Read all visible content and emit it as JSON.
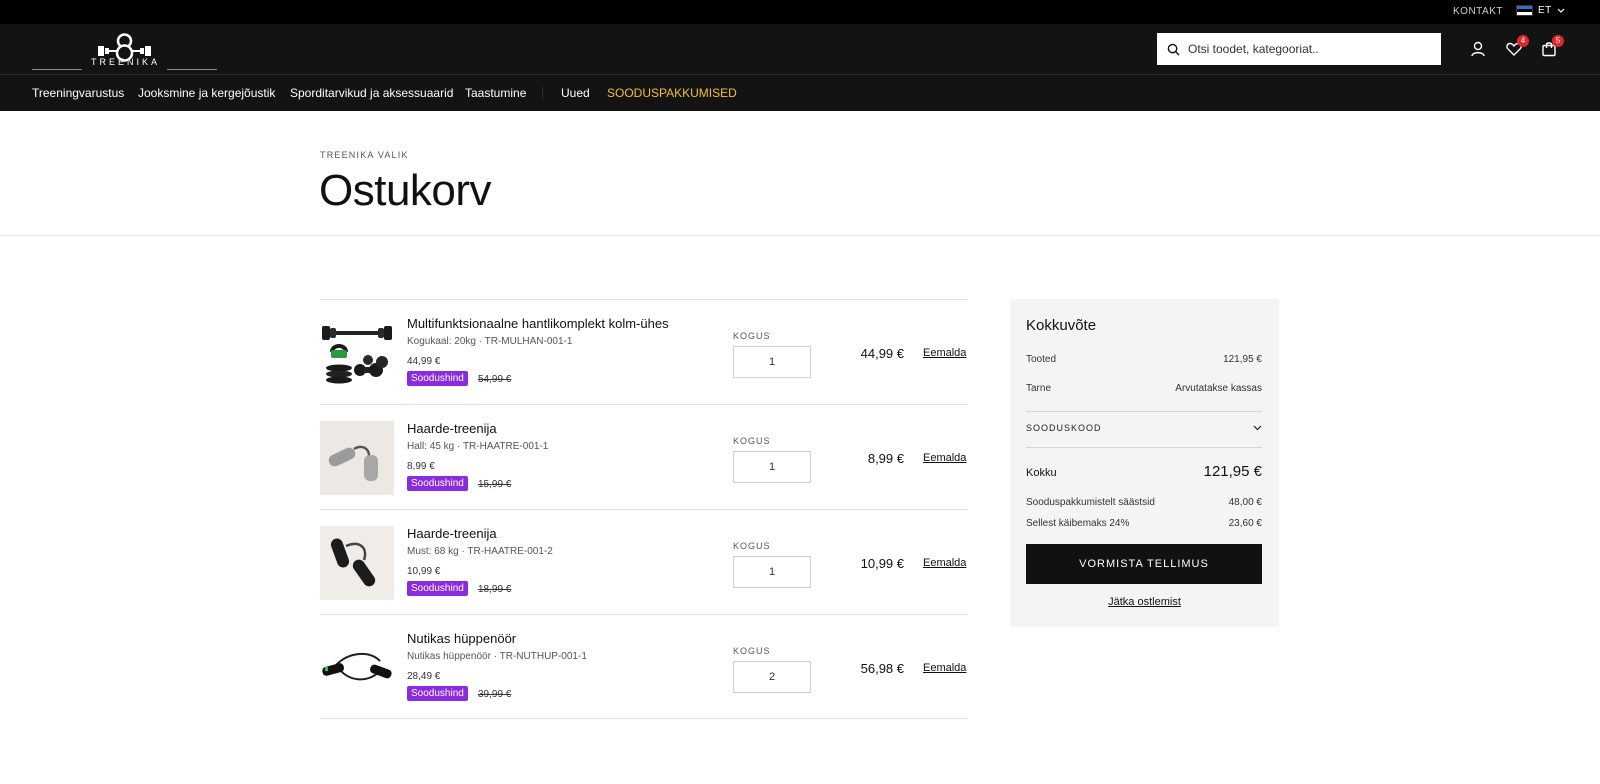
{
  "topbar": {
    "contact": "KONTAKT",
    "lang": "ET"
  },
  "header": {
    "brand": "TREENIKA",
    "search_placeholder": "Otsi toodet, kategooriat..",
    "wishlist_count": "4",
    "cart_count": "5"
  },
  "nav": [
    "Treeningvarustus",
    "Jooksmine ja kergejõustik",
    "Sporditarvikud ja aksessuaarid",
    "Taastumine",
    "Uued",
    "SOODUSPAKKUMISED"
  ],
  "page": {
    "breadcrumb": "TREENIKA VALIK",
    "title": "Ostukorv"
  },
  "cart": {
    "qty_label": "KOGUS",
    "remove_label": "Eemalda",
    "sale_label": "Soodushind",
    "items": [
      {
        "name": "Multifunktsionaalne hantlikomplekt kolm-ühes",
        "variant": "Kogukaal: 20kg · TR-MULHAN-001-1",
        "price": "44,99 €",
        "old_price": "54,99 €",
        "qty": "1",
        "total": "44,99 €"
      },
      {
        "name": "Haarde-treenija",
        "variant": "Hall: 45 kg · TR-HAATRE-001-1",
        "price": "8,99 €",
        "old_price": "15,99 €",
        "qty": "1",
        "total": "8,99 €"
      },
      {
        "name": "Haarde-treenija",
        "variant": "Must: 68 kg · TR-HAATRE-001-2",
        "price": "10,99 €",
        "old_price": "18,99 €",
        "qty": "1",
        "total": "10,99 €"
      },
      {
        "name": "Nutikas hüppenöör",
        "variant": "Nutikas hüppenöör · TR-NUTHUP-001-1",
        "price": "28,49 €",
        "old_price": "39,99 €",
        "qty": "2",
        "total": "56,98 €"
      }
    ]
  },
  "summary": {
    "title": "Kokkuvõte",
    "products_label": "Tooted",
    "products_value": "121,95 €",
    "shipping_label": "Tarne",
    "shipping_value": "Arvutatakse kassas",
    "promo_label": "SOODUSKOOD",
    "total_label": "Kokku",
    "total_value": "121,95 €",
    "savings_label": "Sooduspakkumistelt säästsid",
    "savings_value": "48,00 €",
    "vat_label": "Sellest käibemaks 24%",
    "vat_value": "23,60 €",
    "checkout_label": "VORMISTA TELLIMUS",
    "continue_label": "Jätka ostlemist"
  },
  "colors": {
    "accent_sale": "#f2c030",
    "badge": "#e0262f",
    "sale_tag": "#8a2be2"
  }
}
